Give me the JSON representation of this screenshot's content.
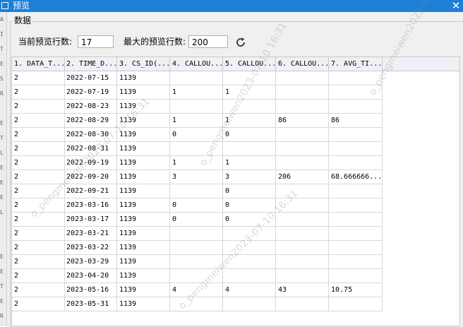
{
  "window": {
    "title": "预览"
  },
  "group": {
    "legend": "数据"
  },
  "controls": {
    "current_rows_label": "当前预览行数:",
    "current_rows_value": "17",
    "max_rows_label": "最大的预览行数:",
    "max_rows_value": "200"
  },
  "table": {
    "columns": [
      "1. DATA_T...",
      "2. TIME_D...",
      "3. CS_ID(...",
      "4. CALLOU...",
      "5. CALLOU...",
      "6. CALLOU...",
      "7. AVG_TI..."
    ],
    "rows": [
      [
        "2",
        "2022-07-15",
        "1139",
        "",
        "",
        "",
        ""
      ],
      [
        "2",
        "2022-07-19",
        "1139",
        "1",
        "1",
        "",
        ""
      ],
      [
        "2",
        "2022-08-23",
        "1139",
        "",
        "",
        "",
        ""
      ],
      [
        "2",
        "2022-08-29",
        "1139",
        "1",
        "1",
        "86",
        "86"
      ],
      [
        "2",
        "2022-08-30",
        "1139",
        "0",
        "0",
        "",
        ""
      ],
      [
        "2",
        "2022-08-31",
        "1139",
        "",
        "",
        "",
        ""
      ],
      [
        "2",
        "2022-09-19",
        "1139",
        "1",
        "1",
        "",
        ""
      ],
      [
        "2",
        "2022-09-20",
        "1139",
        "3",
        "3",
        "206",
        "68.666666..."
      ],
      [
        "2",
        "2022-09-21",
        "1139",
        "",
        "0",
        "",
        ""
      ],
      [
        "2",
        "2023-03-16",
        "1139",
        "0",
        "0",
        "",
        ""
      ],
      [
        "2",
        "2023-03-17",
        "1139",
        "0",
        "0",
        "",
        ""
      ],
      [
        "2",
        "2023-03-21",
        "1139",
        "",
        "",
        "",
        ""
      ],
      [
        "2",
        "2023-03-22",
        "1139",
        "",
        "",
        "",
        ""
      ],
      [
        "2",
        "2023-03-29",
        "1139",
        "",
        "",
        "",
        ""
      ],
      [
        "2",
        "2023-04-20",
        "1139",
        "",
        "",
        "",
        ""
      ],
      [
        "2",
        "2023-05-16",
        "1139",
        "4",
        "4",
        "43",
        "10.75"
      ],
      [
        "2",
        "2023-05-31",
        "1139",
        "",
        "",
        "",
        ""
      ]
    ]
  },
  "left_strip_chars": [
    "A",
    "I",
    "T",
    "E",
    "S",
    "R",
    "",
    "E",
    "T",
    "L",
    "E",
    "E",
    "E",
    "L",
    "",
    "",
    "E",
    "E",
    "T",
    "E",
    "R"
  ],
  "watermarks": [
    "o_pengmeiwen2023-07-10 16:31",
    "o_pengmeiwen2023-07-10 16:31",
    "o_pengmeiwen2023-07-10 16:31",
    "o_pengmeiwen2023-07-10 16:31"
  ],
  "colors": {
    "titlebar": "#1e7fd6",
    "accent_refresh": "#333333"
  }
}
